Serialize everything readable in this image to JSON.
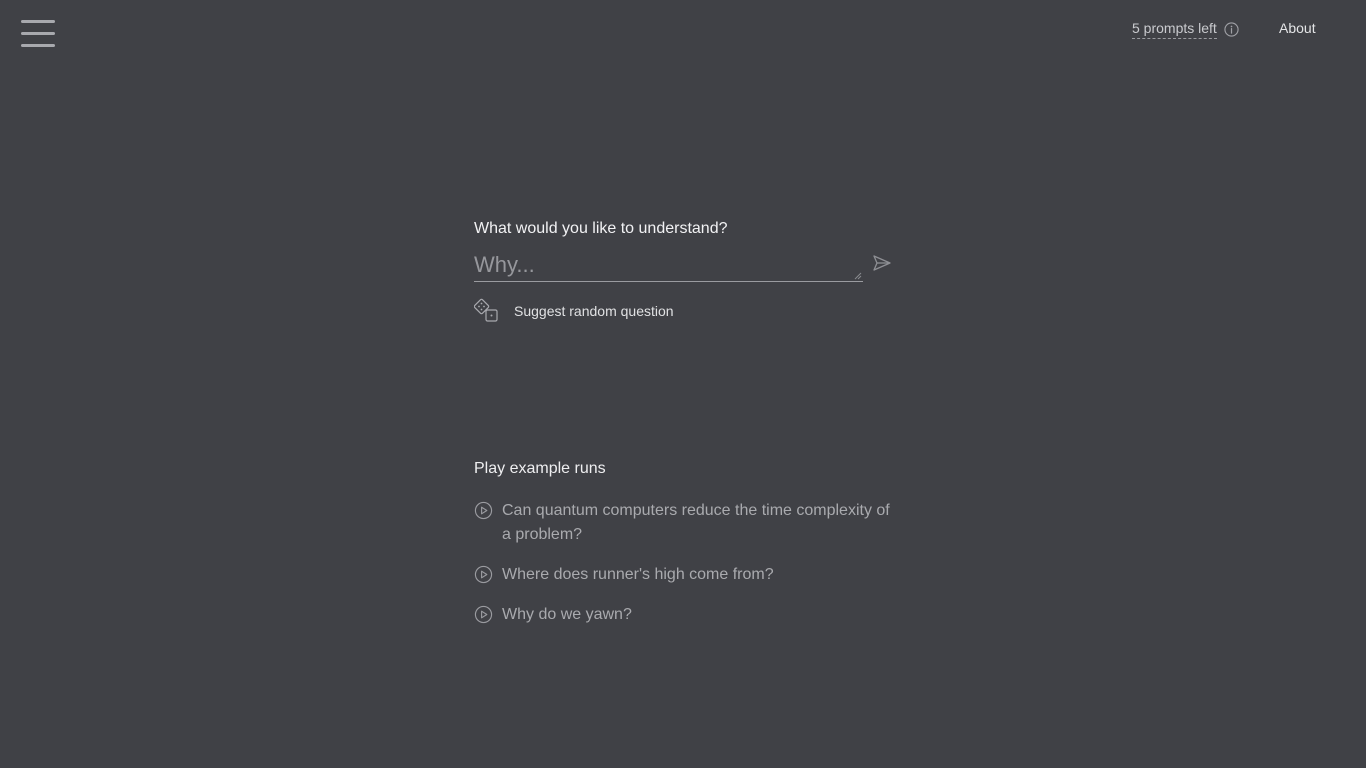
{
  "header": {
    "menu_icon": "hamburger-icon",
    "prompts_left": "5 prompts left",
    "info_icon": "info-icon",
    "about_label": "About"
  },
  "ask": {
    "label": "What would you like to understand?",
    "placeholder": "Why...",
    "value": "",
    "send_icon": "send-icon",
    "suggest_label": "Suggest random question",
    "suggest_icon": "dice-icon"
  },
  "examples": {
    "title": "Play example runs",
    "items": [
      {
        "icon": "play-circle-icon",
        "label": "Can quantum computers reduce the time complexity of a problem?"
      },
      {
        "icon": "play-circle-icon",
        "label": "Where does runner's high come from?"
      },
      {
        "icon": "play-circle-icon",
        "label": "Why do we yawn?"
      }
    ]
  },
  "colors": {
    "background": "#404146",
    "text_primary": "#f2f2f4",
    "text_muted": "#a9aaae"
  }
}
